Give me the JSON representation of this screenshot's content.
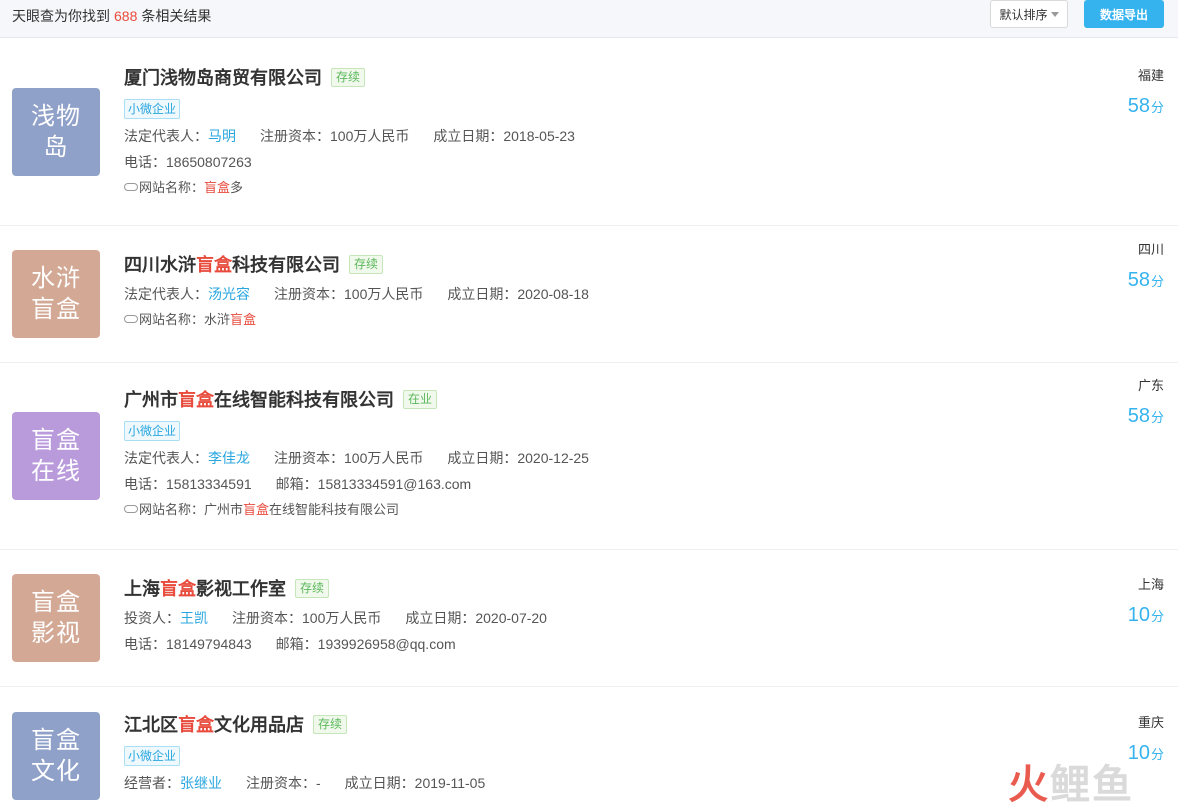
{
  "header": {
    "summary_prefix": "天眼查为你找到",
    "result_count": "688",
    "summary_suffix": "条相关结果",
    "sort_label": "默认排序",
    "export_label": "数据导出"
  },
  "results": [
    {
      "logo_text": "浅物岛",
      "logo_color": "#8fa1c9",
      "name_parts": [
        "厦门浅物岛商贸有限公司",
        "",
        ""
      ],
      "status": "存续",
      "tag": "小微企业",
      "rep_label": "法定代表人：",
      "rep_name": "马明",
      "capital": "注册资本：100万人民币",
      "founded": "成立日期：2018-05-23",
      "phone": "电话：18650807263",
      "email": "",
      "website_label": "网站名称：",
      "website_parts": [
        "",
        "盲盒",
        "多"
      ],
      "province": "福建",
      "score": "58",
      "score_unit": "分"
    },
    {
      "logo_text": "水浒 盲盒",
      "logo_color": "#d3a996",
      "name_parts": [
        "四川水浒",
        "盲盒",
        "科技有限公司"
      ],
      "status": "存续",
      "tag": "",
      "rep_label": "法定代表人：",
      "rep_name": "汤光容",
      "capital": "注册资本：100万人民币",
      "founded": "成立日期：2020-08-18",
      "phone": "",
      "email": "",
      "website_label": "网站名称：",
      "website_parts": [
        "水浒",
        "盲盒",
        ""
      ],
      "province": "四川",
      "score": "58",
      "score_unit": "分"
    },
    {
      "logo_text": "盲盒 在线",
      "logo_color": "#b99bdc",
      "name_parts": [
        "广州市",
        "盲盒",
        "在线智能科技有限公司"
      ],
      "status": "在业",
      "tag": "小微企业",
      "rep_label": "法定代表人：",
      "rep_name": "李佳龙",
      "capital": "注册资本：100万人民币",
      "founded": "成立日期：2020-12-25",
      "phone": "电话：15813334591",
      "email": "邮箱：15813334591@163.com",
      "website_label": "网站名称：",
      "website_parts": [
        "广州市",
        "盲盒",
        "在线智能科技有限公司"
      ],
      "province": "广东",
      "score": "58",
      "score_unit": "分"
    },
    {
      "logo_text": "盲盒 影视",
      "logo_color": "#d3a996",
      "name_parts": [
        "上海",
        "盲盒",
        "影视工作室"
      ],
      "status": "存续",
      "tag": "",
      "rep_label": "投资人：",
      "rep_name": "王凯",
      "capital": "注册资本：100万人民币",
      "founded": "成立日期：2020-07-20",
      "phone": "电话：18149794843",
      "email": "邮箱：1939926958@qq.com",
      "website_label": "",
      "website_parts": [
        "",
        "",
        ""
      ],
      "province": "上海",
      "score": "10",
      "score_unit": "分"
    },
    {
      "logo_text": "盲盒 文化",
      "logo_color": "#8fa1c9",
      "name_parts": [
        "江北区",
        "盲盒",
        "文化用品店"
      ],
      "status": "存续",
      "tag": "小微企业",
      "rep_label": "经营者：",
      "rep_name": "张继业",
      "capital": "注册资本：-",
      "founded": "成立日期：2019-11-05",
      "phone": "",
      "email": "",
      "website_label": "",
      "website_parts": [
        "",
        "",
        ""
      ],
      "province": "重庆",
      "score": "10",
      "score_unit": "分"
    }
  ],
  "watermark": {
    "part1": "火",
    "part2": "鲤鱼"
  }
}
